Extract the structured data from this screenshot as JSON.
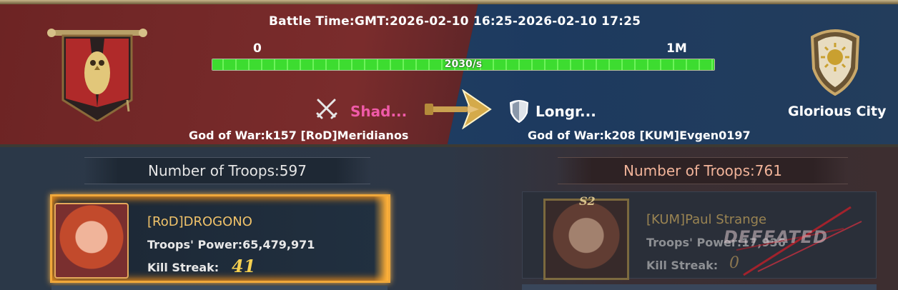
{
  "header": {
    "battle_time": "Battle Time:GMT:2026-02-10 16:25-2026-02-10 17:25",
    "progress_min_label": "0",
    "progress_max_label": "1M",
    "progress_rate": "2030/s",
    "progress_fraction": 1.0
  },
  "attacker": {
    "alliance_name": "Shad...",
    "commander": "God of War:k157 [RoD]Meridianos"
  },
  "defender": {
    "alliance_name": "Longr...",
    "commander": "God of War:k208 [KUM]Evgen0197",
    "city_name": "Glorious City"
  },
  "left_panel": {
    "troops_label": "Number of Troops:597",
    "player": {
      "name": "[RoD]DROGONO",
      "power": "Troops' Power:65,479,971",
      "kill_streak_label": "Kill Streak:",
      "kill_streak_value": "41"
    }
  },
  "right_panel": {
    "troops_label": "Number of Troops:761",
    "player": {
      "season_badge": "S2",
      "name": "[KUM]Paul Strange",
      "power": "Troops' Power:17,936",
      "kill_streak_label": "Kill Streak:",
      "kill_streak_value": "0",
      "status": "DEFEATED"
    }
  },
  "colors": {
    "attacker_name": "#f05aa8",
    "progress_fill": "#3ddc30",
    "highlight_border": "#f0a83a",
    "streak_value": "#f5d050"
  }
}
